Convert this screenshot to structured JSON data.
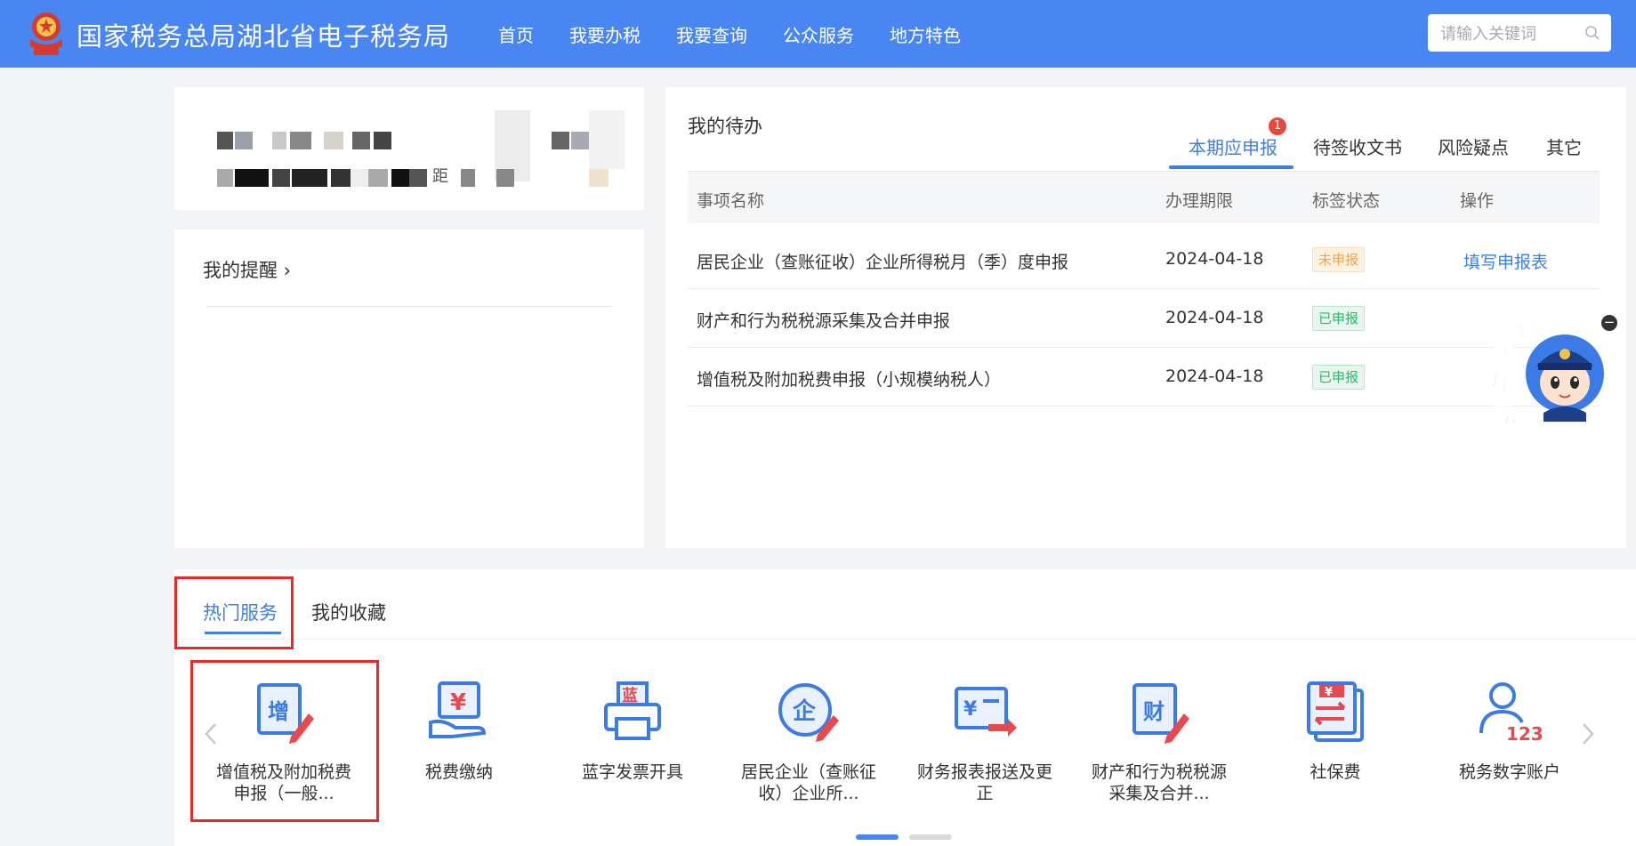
{
  "header": {
    "title": "国家税务总局湖北省电子税务局",
    "nav": [
      "首页",
      "我要办税",
      "我要查询",
      "公众服务",
      "地方特色"
    ],
    "search_placeholder": "请输入关键词",
    "bg_color": "#4a86f2"
  },
  "user_card": {
    "partial_text": "距"
  },
  "reminders": {
    "title": "我的提醒 ›"
  },
  "todo": {
    "title": "我的待办",
    "tabs": [
      "本期应申报",
      "待签收文书",
      "风险疑点",
      "其它"
    ],
    "active_tab": "本期应申报",
    "badge": "1",
    "columns": [
      "事项名称",
      "办理期限",
      "标签状态",
      "操作"
    ],
    "rows": [
      {
        "name": "居民企业（查账征收）企业所得税月（季）度申报",
        "deadline": "2024-04-18",
        "status": "未申报",
        "status_type": "orange",
        "action": "填写申报表"
      },
      {
        "name": "财产和行为税税源采集及合并申报",
        "deadline": "2024-04-18",
        "status": "已申报",
        "status_type": "green",
        "action": ""
      },
      {
        "name": "增值税及附加税费申报（小规模纳税人）",
        "deadline": "2024-04-18",
        "status": "已申报",
        "status_type": "green",
        "action": ""
      }
    ]
  },
  "mascot": {
    "text": [
      "征",
      "纳",
      "互",
      "动"
    ],
    "close": "−"
  },
  "services": {
    "tabs": [
      "热门服务",
      "我的收藏"
    ],
    "active_tab": "热门服务",
    "items": [
      {
        "label": "增值税及附加税费申报（一般...",
        "icon": "vat-declare-icon"
      },
      {
        "label": "税费缴纳",
        "icon": "tax-payment-icon"
      },
      {
        "label": "蓝字发票开具",
        "icon": "invoice-printer-icon"
      },
      {
        "label": "居民企业（查账征收）企业所...",
        "icon": "enterprise-tax-icon"
      },
      {
        "label": "财务报表报送及更正",
        "icon": "financial-report-icon"
      },
      {
        "label": "财产和行为税税源采集及合并...",
        "icon": "property-tax-icon"
      },
      {
        "label": "社保费",
        "icon": "social-security-icon"
      },
      {
        "label": "税务数字账户",
        "icon": "digital-account-icon"
      }
    ],
    "icon_text": {
      "vat": "增",
      "pay": "¥",
      "invoice": "蓝",
      "enterprise": "企",
      "report": "¥",
      "property": "财",
      "social": "¥",
      "account": "123"
    },
    "active_page": 1,
    "pages": 2
  },
  "colors": {
    "accent": "#3f7ee8",
    "highlight_box": "#e8292a",
    "icon_blue": "#3c7be6",
    "icon_red": "#e8494d"
  }
}
